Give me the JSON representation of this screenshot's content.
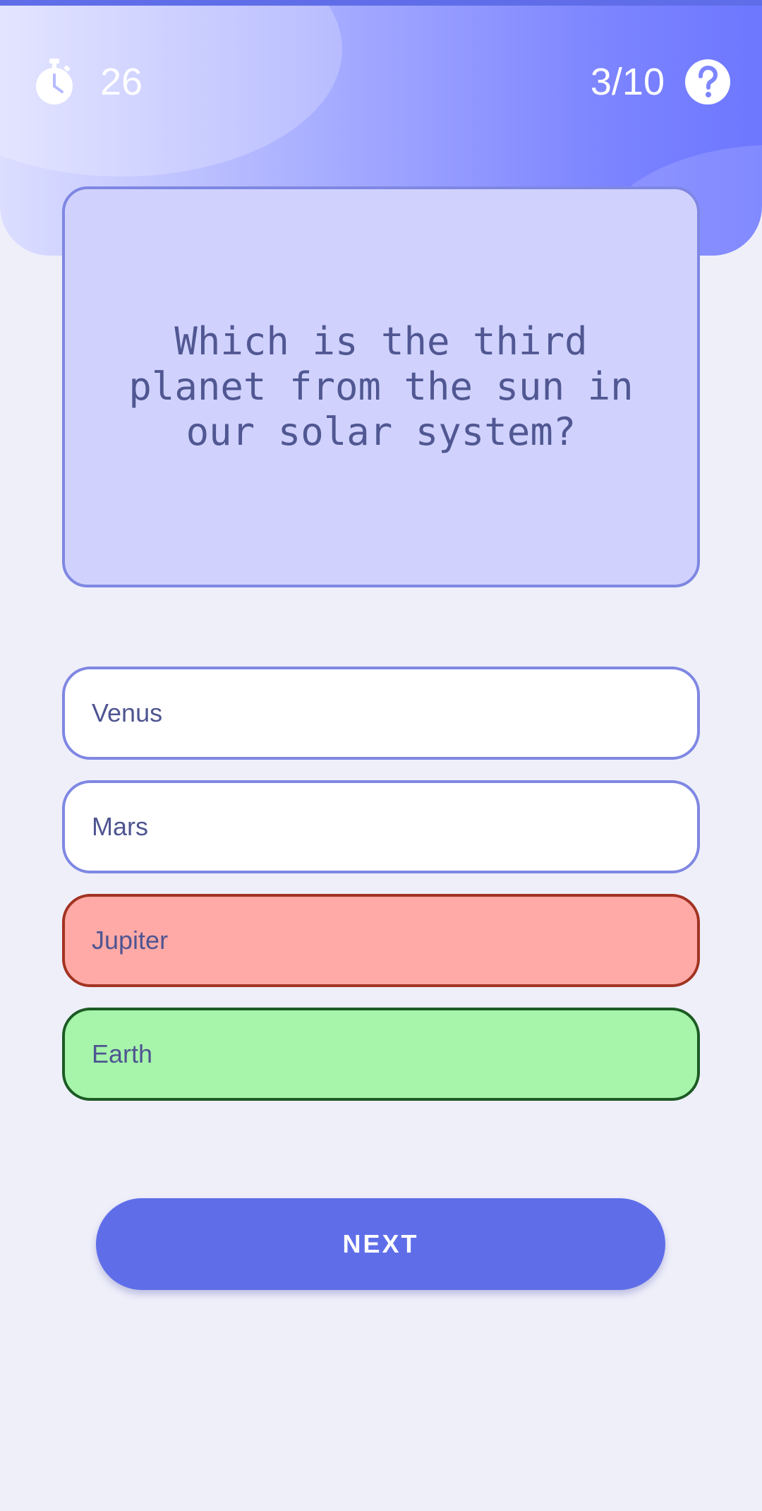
{
  "theme": {
    "accent": "#5f6ee8",
    "question_card_bg": "#d0d2fd",
    "wrong_answer": "#ffaaa6",
    "correct_answer": "#a6f5aa"
  },
  "header": {
    "timer_icon": "stopwatch-icon",
    "timer_value": "26",
    "progress": "3/10",
    "help_icon": "help-circle-icon"
  },
  "question": {
    "text": "Which is the third planet from the sun in our solar system?"
  },
  "options": [
    {
      "label": "Venus",
      "state": "default"
    },
    {
      "label": "Mars",
      "state": "default"
    },
    {
      "label": "Jupiter",
      "state": "wrong"
    },
    {
      "label": "Earth",
      "state": "correct"
    }
  ],
  "actions": {
    "next_label": "NEXT"
  }
}
